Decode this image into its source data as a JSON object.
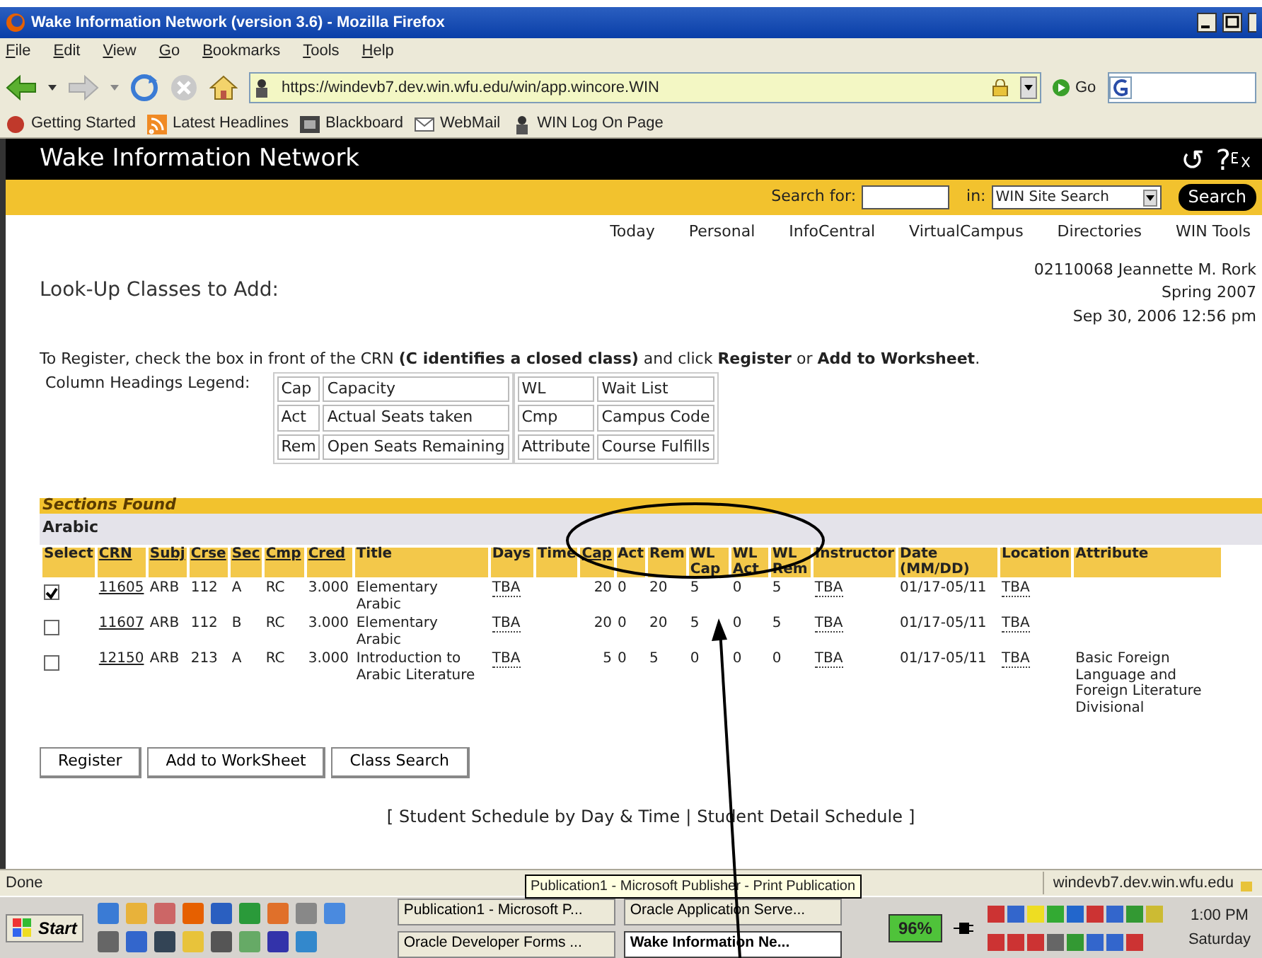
{
  "window": {
    "title": "Wake Information Network (version 3.6) - Mozilla Firefox"
  },
  "menu": [
    "File",
    "Edit",
    "View",
    "Go",
    "Bookmarks",
    "Tools",
    "Help"
  ],
  "address": {
    "url": "https://windevb7.dev.win.wfu.edu/win/app.wincore.WIN",
    "go": "Go"
  },
  "bookmarks": [
    "Getting Started",
    "Latest Headlines",
    "Blackboard",
    "WebMail",
    "WIN Log On Page"
  ],
  "site": {
    "title": "Wake Information Network",
    "header_icons": [
      "↺",
      "?"
    ]
  },
  "search": {
    "label": "Search for:",
    "in_label": "in:",
    "scope": "WIN Site Search",
    "button": "Search"
  },
  "nav_links": [
    "Today",
    "Personal",
    "InfoCentral",
    "VirtualCampus",
    "Directories",
    "WIN Tools"
  ],
  "page_title": "Look-Up Classes to Add:",
  "user_info": [
    "02110068 Jeannette M. Rork",
    "Spring 2007",
    "Sep 30, 2006 12:56 pm"
  ],
  "instructions": "To Register, check the box in front of the CRN **(C identifies a closed class)** and click **Register** or **Add to Worksheet**.",
  "legend": {
    "label": "Column Headings Legend:",
    "groups": [
      [
        {
          "code": "Cap",
          "meaning": "Capacity"
        },
        {
          "code": "Act",
          "meaning": "Actual Seats taken"
        },
        {
          "code": "Rem",
          "meaning": "Open Seats Remaining"
        }
      ],
      [
        {
          "code": "WL",
          "meaning": "Wait List"
        },
        {
          "code": "Cmp",
          "meaning": "Campus Code"
        },
        {
          "code": "Attribute",
          "meaning": "Course Fulfills"
        }
      ]
    ]
  },
  "sections": {
    "title": "Sections Found",
    "subject": "Arabic",
    "columns": [
      {
        "label": "Select",
        "kind": "checkbox",
        "underlined": false
      },
      {
        "label": "CRN",
        "kind": "link",
        "underlined": true
      },
      {
        "label": "Subj",
        "kind": "text",
        "underlined": true
      },
      {
        "label": "Crse",
        "kind": "text",
        "underlined": true
      },
      {
        "label": "Sec",
        "kind": "text",
        "underlined": true
      },
      {
        "label": "Cmp",
        "kind": "text",
        "underlined": true
      },
      {
        "label": "Cred",
        "kind": "text",
        "underlined": true
      },
      {
        "label": "Title",
        "kind": "text",
        "underlined": false
      },
      {
        "label": "Days",
        "kind": "abbr",
        "underlined": false
      },
      {
        "label": "Time",
        "kind": "text",
        "underlined": false
      },
      {
        "label": "Cap",
        "kind": "number",
        "underlined": true
      },
      {
        "label": "Act",
        "kind": "text",
        "underlined": false
      },
      {
        "label": "Rem",
        "kind": "text",
        "underlined": false
      },
      {
        "label": "WL Cap",
        "kind": "text",
        "underlined": false
      },
      {
        "label": "WL Act",
        "kind": "text",
        "underlined": false
      },
      {
        "label": "WL Rem",
        "kind": "text",
        "underlined": false
      },
      {
        "label": "Instructor",
        "kind": "abbr",
        "underlined": false
      },
      {
        "label": "Date (MM/DD)",
        "kind": "text",
        "underlined": false
      },
      {
        "label": "Location",
        "kind": "abbr",
        "underlined": false
      },
      {
        "label": "Attribute",
        "kind": "text",
        "underlined": false
      }
    ],
    "rows": [
      {
        "selected": true,
        "cells": [
          null,
          "11605",
          "ARB",
          "112",
          "A",
          "RC",
          "3.000",
          "Elementary Arabic",
          "TBA",
          null,
          "20",
          "0",
          "20",
          "5",
          "0",
          "5",
          "TBA",
          "01/17-05/11",
          "TBA",
          null
        ]
      },
      {
        "selected": false,
        "cells": [
          null,
          "11607",
          "ARB",
          "112",
          "B",
          "RC",
          "3.000",
          "Elementary Arabic",
          "TBA",
          null,
          "20",
          "0",
          "20",
          "5",
          "0",
          "5",
          "TBA",
          "01/17-05/11",
          "TBA",
          null
        ]
      },
      {
        "selected": false,
        "cells": [
          null,
          "12150",
          "ARB",
          "213",
          "A",
          "RC",
          "3.000",
          "Introduction to Arabic Literature",
          "TBA",
          null,
          "5",
          "0",
          "5",
          "0",
          "0",
          "0",
          "TBA",
          "01/17-05/11",
          "TBA",
          "Basic Foreign Language and Foreign Literature Divisional"
        ]
      }
    ]
  },
  "buttons": [
    "Register",
    "Add to WorkSheet",
    "Class Search"
  ],
  "footer": {
    "open": "[",
    "sep": "|",
    "close": "]",
    "links": [
      "Student Schedule by Day & Time",
      "Student Detail Schedule"
    ]
  },
  "status_bar": {
    "text": "Done",
    "host": "windevb7.dev.win.wfu.edu"
  },
  "tooltip": "Publication1 - Microsoft Publisher - Print Publication",
  "taskbar": {
    "start": "Start",
    "tasks": [
      {
        "label": "Publication1 - Microsoft P...",
        "selected": false
      },
      {
        "label": "Oracle Application Serve...",
        "selected": false
      },
      {
        "label": "Oracle Developer Forms ...",
        "selected": false
      },
      {
        "label": "Wake Information Ne...",
        "selected": true
      }
    ],
    "battery": "96%",
    "clock": "1:00 PM",
    "day": "Saturday"
  }
}
